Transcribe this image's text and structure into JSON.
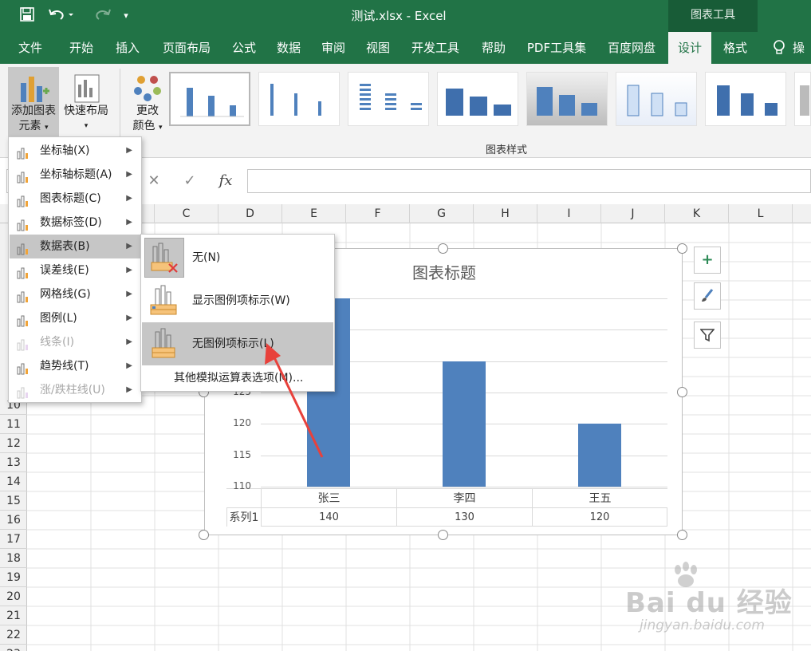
{
  "titlebar": {
    "doc_title": "测试.xlsx  -  Excel",
    "context_group": "图表工具",
    "save_icon": "save-icon",
    "undo_icon": "undo-icon",
    "redo_icon": "redo-icon",
    "customize_icon": "customize-qat-icon"
  },
  "tabs": [
    "文件",
    "开始",
    "插入",
    "页面布局",
    "公式",
    "数据",
    "审阅",
    "视图",
    "开发工具",
    "帮助",
    "PDF工具集",
    "百度网盘",
    "设计",
    "格式",
    "操"
  ],
  "active_tab": "设计",
  "ribbon": {
    "add_element_line1": "添加图表",
    "add_element_line2": "元素",
    "quick_layout": "快速布局",
    "change_colors_line1": "更改",
    "change_colors_line2": "颜色",
    "styles_group_label": "图表样式"
  },
  "formula_bar": {
    "cancel": "✕",
    "enter": "✓",
    "fx": "fx"
  },
  "columns": [
    "C",
    "D",
    "E",
    "F",
    "G",
    "H",
    "I",
    "J",
    "K",
    "L"
  ],
  "rows": [
    "10",
    "11",
    "12",
    "13",
    "14",
    "15",
    "16",
    "17",
    "18",
    "19",
    "20",
    "21",
    "22",
    "23"
  ],
  "chart": {
    "title": "图表标题",
    "y_ticks": [
      "110",
      "115",
      "120",
      "125"
    ],
    "series_name": "系列1"
  },
  "chart_data": {
    "type": "bar",
    "categories": [
      "张三",
      "李四",
      "王五"
    ],
    "series": [
      {
        "name": "系列1",
        "values": [
          140,
          130,
          120
        ]
      }
    ],
    "title": "图表标题",
    "ylim": [
      110,
      140
    ],
    "data_table": true
  },
  "add_element_menu": [
    {
      "label": "坐标轴(X)",
      "icon": "axis-icon",
      "disabled": false
    },
    {
      "label": "坐标轴标题(A)",
      "icon": "axis-title-icon",
      "disabled": false
    },
    {
      "label": "图表标题(C)",
      "icon": "chart-title-icon",
      "disabled": false
    },
    {
      "label": "数据标签(D)",
      "icon": "data-labels-icon",
      "disabled": false
    },
    {
      "label": "数据表(B)",
      "icon": "data-table-icon",
      "disabled": false
    },
    {
      "label": "误差线(E)",
      "icon": "error-bars-icon",
      "disabled": false
    },
    {
      "label": "网格线(G)",
      "icon": "gridlines-icon",
      "disabled": false
    },
    {
      "label": "图例(L)",
      "icon": "legend-icon",
      "disabled": false
    },
    {
      "label": "线条(I)",
      "icon": "lines-icon",
      "disabled": true
    },
    {
      "label": "趋势线(T)",
      "icon": "trendline-icon",
      "disabled": false
    },
    {
      "label": "涨/跌柱线(U)",
      "icon": "updown-bars-icon",
      "disabled": true
    }
  ],
  "data_table_submenu": {
    "none": "无(N)",
    "with_legend_keys": "显示图例项标示(W)",
    "no_legend_keys": "无图例项标示(L)",
    "more_options": "其他模拟运算表选项(M)..."
  },
  "side_buttons": [
    "chart-elements-plus-icon",
    "chart-styles-brush-icon",
    "chart-filters-icon"
  ],
  "colors": {
    "excel_green": "#217346",
    "bar_blue": "#4f81bd",
    "arrow_red": "#e8413b"
  },
  "watermark": {
    "brand": "Bai du 经验",
    "url": "jingyan.baidu.com"
  }
}
